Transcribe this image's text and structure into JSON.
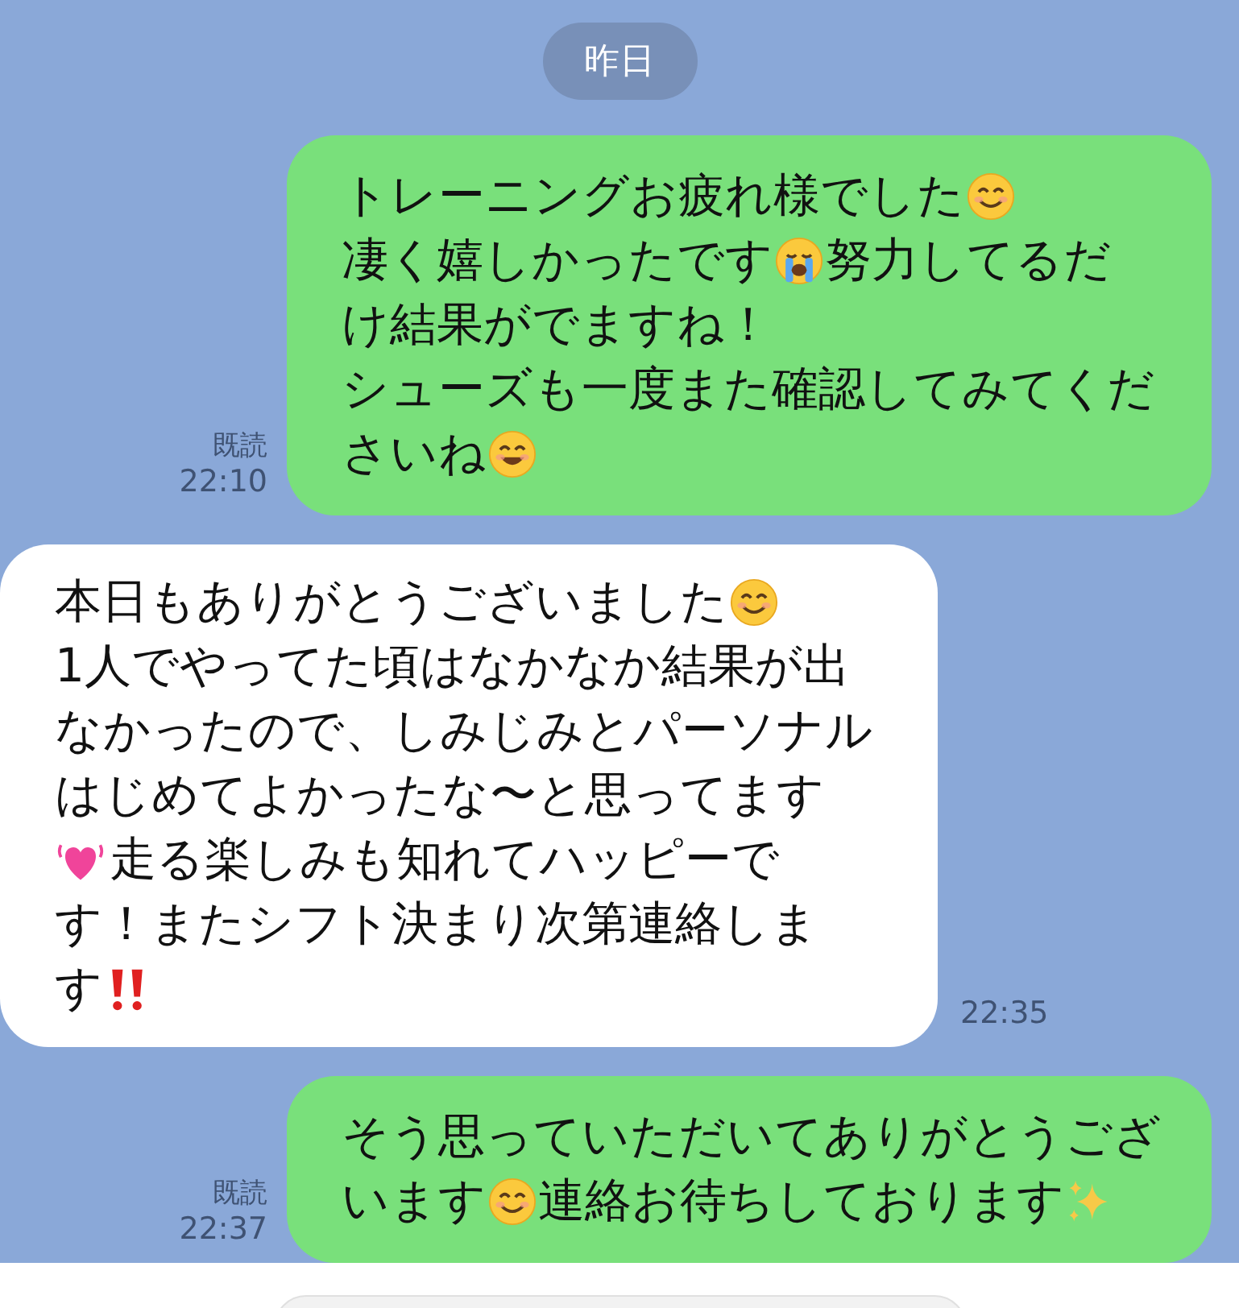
{
  "date_separator": "昨日",
  "messages": [
    {
      "kind": "sent",
      "read_label": "既読",
      "time": "22:10",
      "lines": [
        [
          {
            "kind": "text",
            "text": "トレーニングお疲れ様でした"
          },
          {
            "kind": "smile"
          }
        ],
        [
          {
            "kind": "text",
            "text": "凄く嬉しかったです"
          },
          {
            "kind": "cry"
          },
          {
            "kind": "text",
            "text": "努力してるだ"
          }
        ],
        [
          {
            "kind": "text",
            "text": "け結果がでますね！"
          }
        ],
        [
          {
            "kind": "text",
            "text": "シューズも一度また確認してみてくだ"
          }
        ],
        [
          {
            "kind": "text",
            "text": "さいね"
          },
          {
            "kind": "grin"
          }
        ]
      ]
    },
    {
      "kind": "received",
      "time": "22:35",
      "lines": [
        [
          {
            "kind": "text",
            "text": "本日もありがとうございました"
          },
          {
            "kind": "smile"
          }
        ],
        [
          {
            "kind": "text",
            "text": "1人でやってた頃はなかなか結果が出"
          }
        ],
        [
          {
            "kind": "text",
            "text": "なかったので、しみじみとパーソナル"
          }
        ],
        [
          {
            "kind": "text",
            "text": "はじめてよかったな〜と思ってます"
          }
        ],
        [
          {
            "kind": "heart"
          },
          {
            "kind": "text",
            "text": "走る楽しみも知れてハッピーで"
          }
        ],
        [
          {
            "kind": "text",
            "text": "す！またシフト決まり次第連絡しま"
          }
        ],
        [
          {
            "kind": "text",
            "text": "す"
          },
          {
            "kind": "exclaim"
          }
        ]
      ]
    },
    {
      "kind": "sent",
      "read_label": "既読",
      "time": "22:37",
      "lines": [
        [
          {
            "kind": "text",
            "text": "そう思っていただいてありがとうござ"
          }
        ],
        [
          {
            "kind": "text",
            "text": "います"
          },
          {
            "kind": "smile"
          },
          {
            "kind": "text",
            "text": "連絡お待ちしております"
          },
          {
            "kind": "sparkles"
          }
        ]
      ]
    }
  ]
}
